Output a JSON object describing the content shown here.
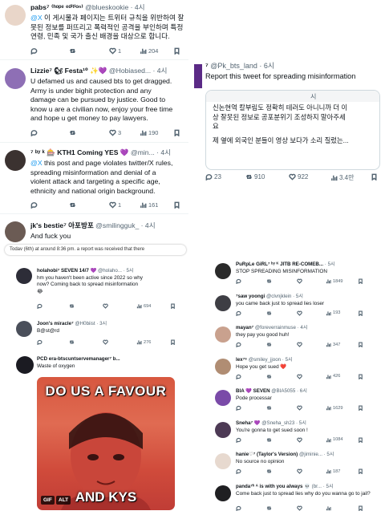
{
  "left_top": [
    {
      "name": "pabs⁷ ⁽ʰᵒᵖᵉ ᵉᵈⁱᵗⁱᵒⁿ⁾",
      "handle": "@blueskookie · 4시",
      "body": [
        {
          "mention": "@X",
          "text": " 이 게시물과 페이지는 트위터 규칙을 위반하여 잘"
        },
        {
          "text": "못된 정보를 퍼뜨리고 폭력적인 공격을 부인하며 특정"
        },
        {
          "text": "연령, 민족 및 국가 출신 배경을 대상으로 합니다."
        }
      ],
      "retweets": "",
      "likes": "1",
      "views": "204",
      "avatar_color": "#e9d6c9"
    },
    {
      "name": "Lizzie⁷ 🐿 Festa¹⁰ ✨💜",
      "handle": "@Hobiased... · 4시",
      "body": [
        {
          "text": "U defamed us and caused bts to get dragged."
        },
        {
          "text": "Army is under bighit protection and any"
        },
        {
          "text": "damage can be pursued by justice. Good to"
        },
        {
          "text": "know u are a civilian now, enjoy your free time"
        },
        {
          "text": "and hope u get money to pay lawyers."
        }
      ],
      "retweets": "",
      "likes": "3",
      "views": "190",
      "avatar_color": "#8e6fb5"
    },
    {
      "name": "⁷ ᵇʸ ᵏ 🎰 KTH1 Coming YES 💜",
      "handle": "@min... · 4시",
      "body": [
        {
          "mention": "@X",
          "text": " this post and page violates twitter/X rules,"
        },
        {
          "text": "spreading misinformation and denial of a"
        },
        {
          "text": "violent attack and targeting a specific age,"
        },
        {
          "text": "ethnicity and national origin background."
        }
      ],
      "retweets": "",
      "likes": "1",
      "views": "161",
      "avatar_color": "#3b3230"
    },
    {
      "name": "jk's bestie⁷ 아포방포",
      "handle": "@smilingguk_ · 4시",
      "body": [
        {
          "text": "And fuck you"
        }
      ],
      "avatar_color": "#6b5b54"
    }
  ],
  "report_banner": "Todav (6th) at around 8:36 pm. a report was received that there",
  "left_bottom": [
    {
      "name": "holahobi⁷ SEVEN 14/7 💜",
      "handle": "@holaho... · 5시",
      "body": [
        "hm you haven't been active since 2022 so why",
        "now? Coming back to spread misinformation",
        "😂"
      ],
      "retweets": "",
      "likes": "",
      "views": "694",
      "avatar_color": "#2d2d38"
    },
    {
      "name": "Joon's miracle⁷",
      "handle": "@H0biist · 3시",
      "body": [
        "B@st@rd"
      ],
      "retweets": "",
      "likes": "",
      "views": "276",
      "avatar_color": "#4a4f5a"
    },
    {
      "name": "PCD era-btscuntservemanager⁷ b...",
      "handle": "",
      "body": [
        "Waste of oxygen"
      ],
      "avatar_color": "#1b1b22"
    }
  ],
  "media": {
    "top_caption": "DO US A FAVOUR",
    "bottom_caption": "AND KYS",
    "badge_gif": "GIF",
    "badge_alt": "ALT"
  },
  "right_top": {
    "name": "⁷",
    "handle": "@Pk_bts_land · 6시",
    "title": "Report this tweet for spreading misinformation",
    "quote_time": "시",
    "quote_lines": [
      "신논현역 칼부림도 정확히 테러도 아니니까 더 이",
      "상 잘못된 정보로 공포분위기 조성하지 말아주세",
      "요"
    ],
    "quote_line2": "제 옆에 외국인 분들이 영상 보다가 소리 질렀는...",
    "replies": "23",
    "retweets": "910",
    "likes": "922",
    "views": "3.4만"
  },
  "right_list": [
    {
      "name": "PuRpLe GiRL⁷ ᵇʸ ᴷ JITB RE-COMEB...",
      "handle": "· 5시",
      "body": "STOP SPREADING MISINFORMATION",
      "views": "1849",
      "avatar_color": "#2a2a2a"
    },
    {
      "name": "⁷saw yoongi",
      "handle": "@clvnjklein · 5시",
      "body": "you came back just to spread lies loser",
      "views": "193",
      "avatar_color": "#3e3e44"
    },
    {
      "name": "mayan⁷",
      "handle": "@foreverrainmuse · 4시",
      "body": "they pay you good huh!",
      "views": "347",
      "avatar_color": "#c9a18e"
    },
    {
      "name": "lex⁷⁶",
      "handle": "@smiley_jjoon · 5시",
      "body": "Hope you get sued ❤️",
      "views": "426",
      "avatar_color": "#b08d73"
    },
    {
      "name": "BIA 💜 SEVEN",
      "handle": "@BIA5055 · 6시",
      "body": "Pode processar",
      "views": "1629",
      "avatar_color": "#7a4aa8"
    },
    {
      "name": "Sneha⁷ 💜",
      "handle": "@Sneha_sh23 · 5시",
      "body": "You're gonna to get sued soon !",
      "views": "1084",
      "avatar_color": "#4d3a55"
    },
    {
      "name": "hanie♡⁷ (Taylor's Version)",
      "handle": "@jiminie... · 5시",
      "body": "No source no opinion",
      "views": "187",
      "avatar_color": "#e7d9cf"
    },
    {
      "name": "panda⁷ʰ ᴬ is with you always 💀",
      "handle": "(br... · 5시",
      "body": "Come back just to spread lies why do you wanna go to jail?",
      "views": "",
      "avatar_color": "#1f1f22"
    }
  ],
  "icons": [
    "reply-icon",
    "retweet-icon",
    "like-icon",
    "views-icon",
    "bookmark-icon"
  ]
}
